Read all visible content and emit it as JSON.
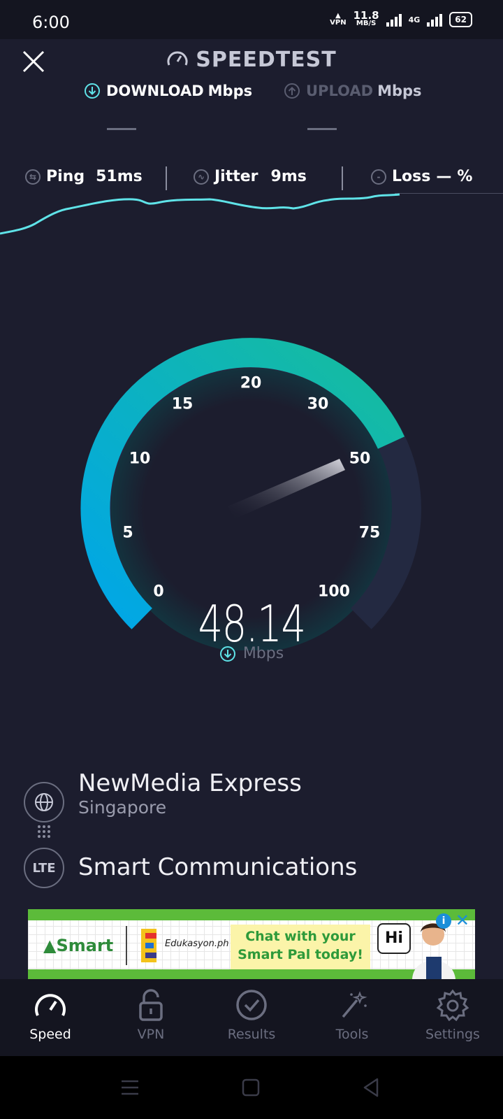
{
  "status_bar": {
    "time": "6:00",
    "net_speed_value": "11.8",
    "net_speed_unit": "MB/S",
    "network": "4G",
    "battery": "62"
  },
  "header": {
    "title": "SPEEDTEST",
    "download_label": "DOWNLOAD",
    "download_unit": "Mbps",
    "upload_label": "UPLOAD",
    "upload_unit": "Mbps"
  },
  "stats": {
    "ping_label": "Ping",
    "ping_value": "51",
    "ping_unit": "ms",
    "jitter_label": "Jitter",
    "jitter_value": "9",
    "jitter_unit": "ms",
    "loss_label": "Loss",
    "loss_value": "—",
    "loss_unit": "%"
  },
  "gauge": {
    "ticks": [
      "0",
      "5",
      "10",
      "15",
      "20",
      "30",
      "50",
      "75",
      "100"
    ],
    "current_value": "48.14",
    "unit": "Mbps"
  },
  "server": {
    "name": "NewMedia Express",
    "location": "Singapore",
    "provider_badge": "LTE",
    "provider": "Smart Communications"
  },
  "ad": {
    "brand": "Smart",
    "edu_brand": "Edukasyon.ph",
    "headline_1": "Chat with your",
    "headline_2": "Smart Pal today!",
    "bubble": "Hi",
    "info_icon": "i",
    "close_icon": "✕"
  },
  "nav": {
    "items": [
      {
        "label": "Speed"
      },
      {
        "label": "VPN"
      },
      {
        "label": "Results"
      },
      {
        "label": "Tools"
      },
      {
        "label": "Settings"
      }
    ]
  },
  "colors": {
    "accent": "#5fe3e8",
    "gauge_blue": "#00a6e8",
    "gauge_teal": "#17bd9c",
    "background": "#1c1d2e"
  }
}
